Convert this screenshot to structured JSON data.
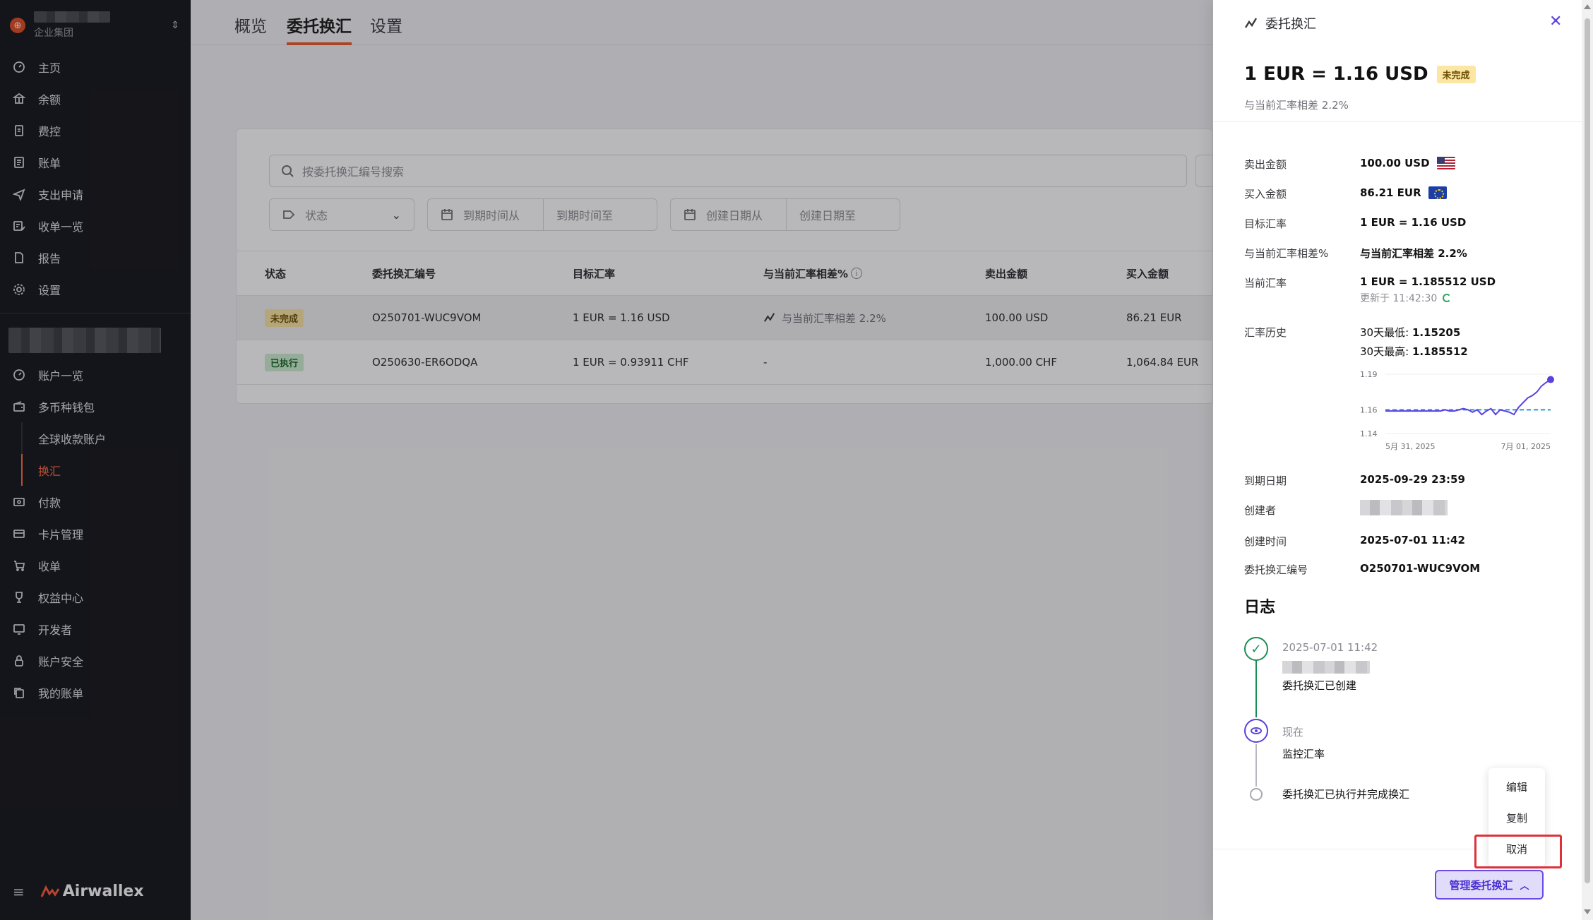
{
  "sidebar": {
    "org_sub": "企业集团",
    "nav": [
      "主页",
      "余额",
      "费控",
      "账单",
      "支出申请",
      "收单一览",
      "报告",
      "设置"
    ],
    "nav2": [
      "账户一览",
      "多币种钱包"
    ],
    "sub_items": [
      "全球收款账户",
      "换汇"
    ],
    "nav3": [
      "付款",
      "卡片管理",
      "收单",
      "权益中心",
      "开发者",
      "账户安全",
      "我的账单"
    ],
    "brand": "Airwallex"
  },
  "tabs": [
    "概览",
    "委托换汇",
    "设置"
  ],
  "search": {
    "placeholder": "按委托换汇编号搜索"
  },
  "filters": {
    "status": "状态",
    "expire_from": "到期时间从",
    "expire_to": "到期时间至",
    "create_from": "创建日期从",
    "create_to": "创建日期至"
  },
  "table": {
    "headers": [
      "状态",
      "委托换汇编号",
      "目标汇率",
      "与当前汇率相差%",
      "卖出金额",
      "买入金额"
    ],
    "info": "i",
    "rows": [
      {
        "status": "未完成",
        "id": "O250701-WUC9VOM",
        "rate": "1 EUR = 1.16 USD",
        "diff": "与当前汇率相差 2.2%",
        "sell": "100.00 USD",
        "buy": "86.21 EUR"
      },
      {
        "status": "已执行",
        "id": "O250630-ER6ODQA",
        "rate": "1 EUR = 0.93911 CHF",
        "diff": "-",
        "sell": "1,000.00 CHF",
        "buy": "1,064.84 EUR"
      }
    ]
  },
  "drawer": {
    "header": "委托换汇",
    "close": "✕",
    "title": "1 EUR = 1.16 USD",
    "badge": "未完成",
    "subtitle": "与当前汇率相差 2.2%",
    "fields": {
      "sell_label": "卖出金额",
      "sell_value": "100.00 USD",
      "buy_label": "买入金额",
      "buy_value": "86.21 EUR",
      "target_label": "目标汇率",
      "target_value": "1 EUR = 1.16 USD",
      "diff_label": "与当前汇率相差%",
      "diff_value": "与当前汇率相差 2.2%",
      "current_label": "当前汇率",
      "current_value": "1 EUR = 1.185512 USD",
      "updated": "更新于 11:42:30",
      "history_label": "汇率历史",
      "low_label": "30天最低:",
      "low_value": "1.15205",
      "high_label": "30天最高:",
      "high_value": "1.185512",
      "expire_label": "到期日期",
      "expire_value": "2025-09-29 23:59",
      "creator_label": "创建者",
      "created_label": "创建时间",
      "created_value": "2025-07-01 11:42",
      "id_label": "委托换汇编号",
      "id_value": "O250701-WUC9VOM"
    },
    "log_title": "日志",
    "log": {
      "t1_time": "2025-07-01 11:42",
      "t1_text": "委托换汇已创建",
      "t2_time": "现在",
      "t2_text": "监控汇率",
      "t3_text": "委托换汇已执行并完成换汇"
    },
    "menu": [
      "编辑",
      "复制",
      "取消"
    ],
    "manage_button": "管理委托换汇"
  },
  "chart_data": {
    "type": "line",
    "title": "",
    "ylim": [
      1.14,
      1.19
    ],
    "yticks": [
      "1.19",
      "1.16",
      "1.14"
    ],
    "xticks": [
      "5月 31, 2025",
      "7月 01, 2025"
    ],
    "target_line": 1.16,
    "series": [
      {
        "values": [
          1.159,
          1.159,
          1.159,
          1.159,
          1.159,
          1.159,
          1.159,
          1.159,
          1.159,
          1.159,
          1.159,
          1.159,
          1.159,
          1.16,
          1.159,
          1.159,
          1.16,
          1.161,
          1.16,
          1.158,
          1.16,
          1.156,
          1.159,
          1.161,
          1.156,
          1.16,
          1.159,
          1.158,
          1.156,
          1.162,
          1.166,
          1.17,
          1.172,
          1.175,
          1.18,
          1.183,
          1.1855
        ]
      }
    ],
    "colors": {
      "line": "#5b3fe0",
      "target": "#1a9bd7"
    }
  }
}
